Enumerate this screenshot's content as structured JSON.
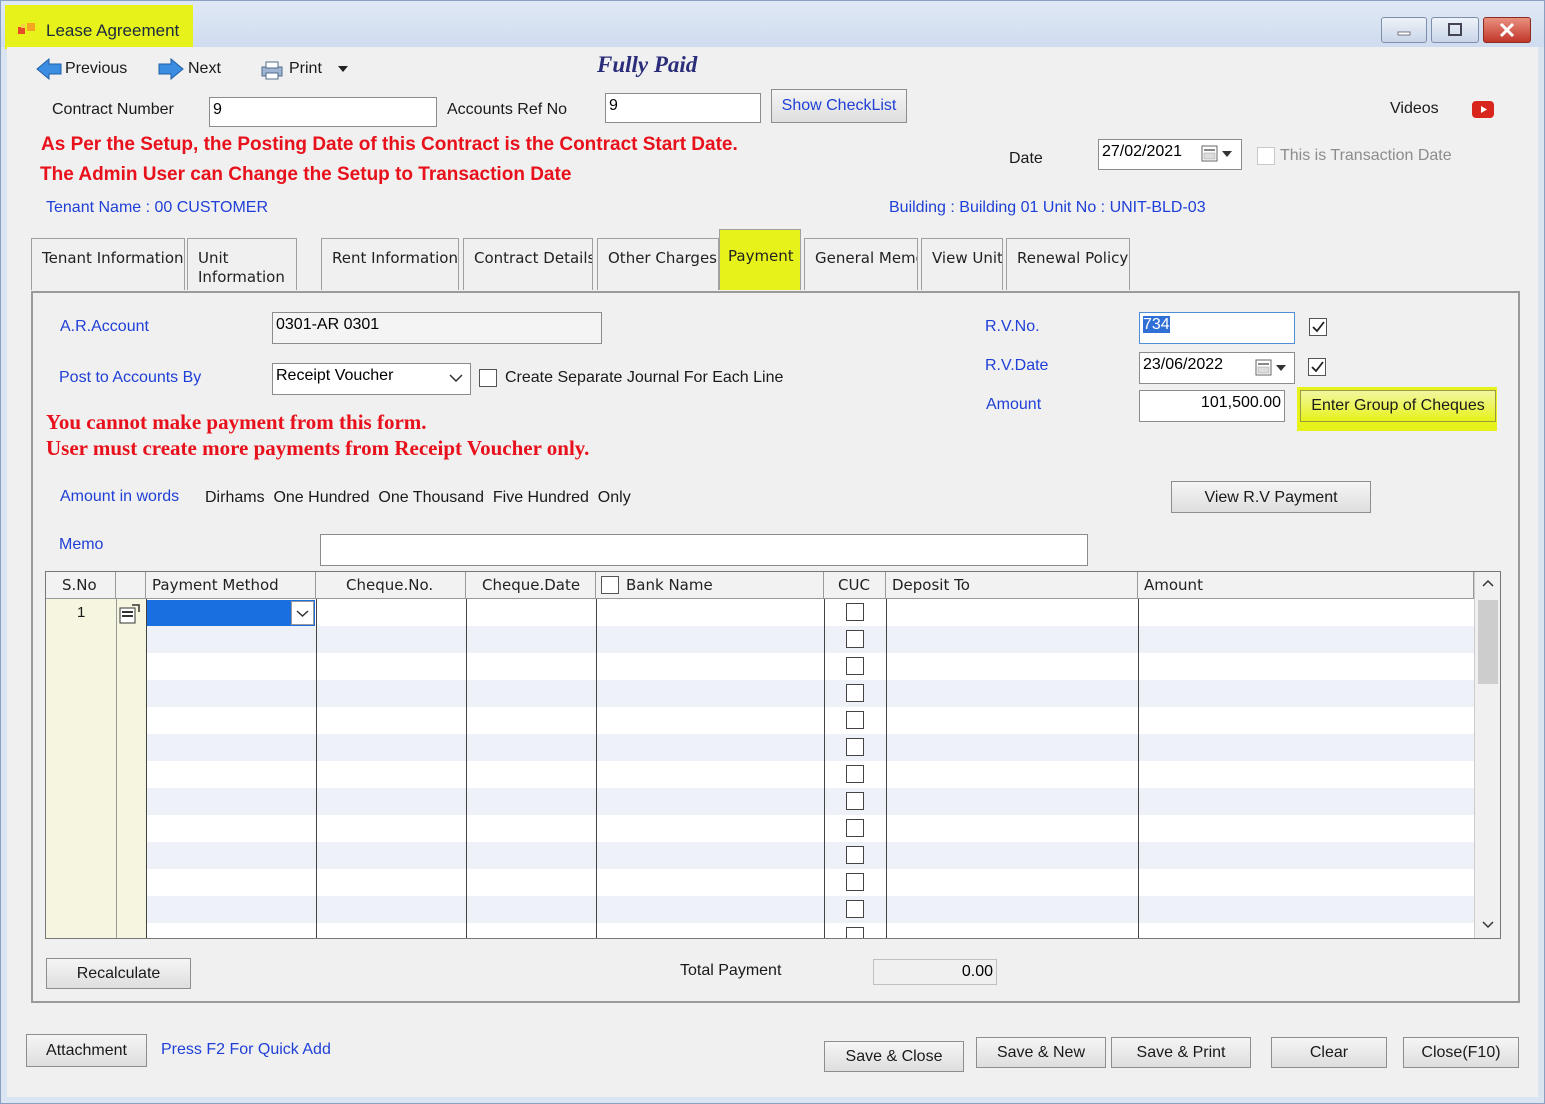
{
  "window": {
    "title": "Lease Agreement"
  },
  "toolbar": {
    "previous": "Previous",
    "next": "Next",
    "print": "Print",
    "status": "Fully Paid"
  },
  "header": {
    "contract_number_label": "Contract Number",
    "contract_number": "9",
    "accounts_ref_label": "Accounts Ref No",
    "accounts_ref": "9",
    "show_checklist": "Show CheckList",
    "videos": "Videos",
    "notice_line1": "As Per the Setup, the Posting Date of this Contract is the Contract Start Date.",
    "notice_line2": "The Admin User can Change the Setup to Transaction Date",
    "date_label": "Date",
    "date_value": "27/02/2021",
    "transaction_date_label": "This is Transaction Date",
    "tenant_name": "Tenant Name : 00 CUSTOMER",
    "building_info": "Building : Building 01  Unit No : UNIT-BLD-03"
  },
  "tabs": [
    {
      "label": "Tenant Information"
    },
    {
      "label": "Unit Information"
    },
    {
      "label": "Rent Information"
    },
    {
      "label": "Contract Details"
    },
    {
      "label": "Other Charges"
    },
    {
      "label": "Payment"
    },
    {
      "label": "General Memo"
    },
    {
      "label": "View Unit"
    },
    {
      "label": "Renewal Policy"
    }
  ],
  "payment": {
    "ar_account_label": "A.R.Account",
    "ar_account": "0301-AR 0301",
    "post_by_label": "Post to Accounts By",
    "post_by": "Receipt Voucher",
    "separate_journal_label": "Create Separate Journal For Each Line",
    "rv_no_label": "R.V.No.",
    "rv_no": "734",
    "rv_date_label": "R.V.Date",
    "rv_date": "23/06/2022",
    "amount_label": "Amount",
    "amount": "101,500.00",
    "enter_group_cheques": "Enter Group of Cheques",
    "warning_line1": "You cannot make payment from this form.",
    "warning_line2": "User must create more payments from Receipt Voucher only.",
    "amount_words_label": "Amount in words",
    "amount_words": "Dirhams  One Hundred  One Thousand  Five Hundred  Only",
    "view_rv_payment": "View R.V Payment",
    "memo_label": "Memo",
    "memo": ""
  },
  "grid": {
    "columns": [
      "S.No",
      "Payment Method",
      "Cheque.No.",
      "Cheque.Date",
      "Bank Name",
      "CUC",
      "Deposit To",
      "Amount"
    ],
    "first_row_sno": "1"
  },
  "footer": {
    "recalculate": "Recalculate",
    "total_payment_label": "Total Payment",
    "total_payment": "0.00",
    "attachment": "Attachment",
    "quick_add_hint": "Press F2 For Quick Add",
    "save_close": "Save & Close",
    "save_new": "Save & New",
    "save_print": "Save & Print",
    "clear": "Clear",
    "close": "Close(F10)"
  },
  "colors": {
    "highlight": "#e6f21a",
    "label_blue": "#1f3fd6",
    "warning_red": "#e8101a",
    "status_navy": "#2b2d7a"
  }
}
